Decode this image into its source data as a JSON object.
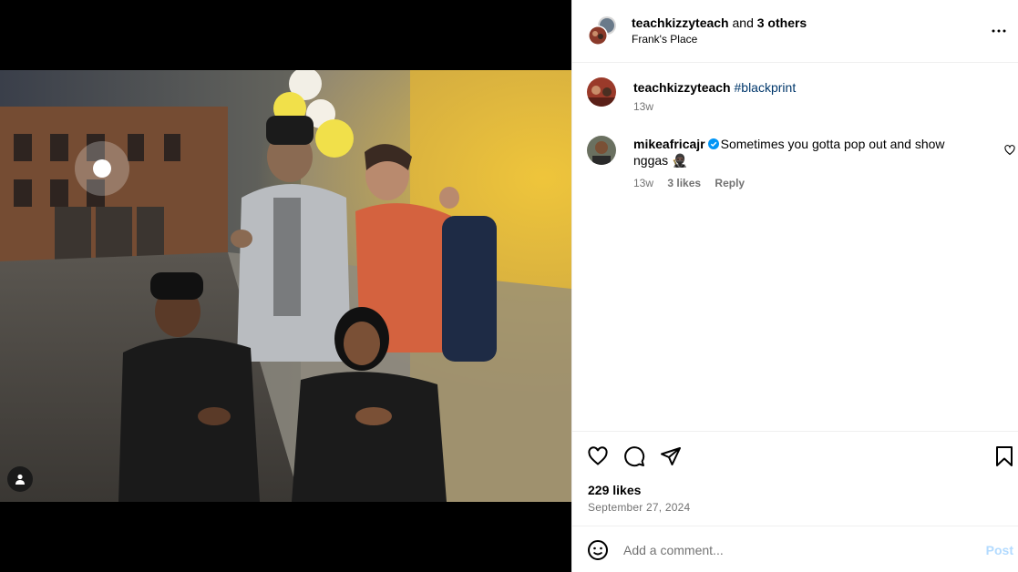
{
  "post": {
    "header": {
      "username": "teachkizzyteach",
      "and_text": "and",
      "others": "3 others",
      "location": "Frank's Place"
    },
    "caption": {
      "username": "teachkizzyteach",
      "hashtag": "#blackprint",
      "time": "13w"
    },
    "comments": [
      {
        "username": "mikeafricajr",
        "verified": true,
        "text": "Sometimes you gotta pop out and show nggas 🥷🏿",
        "time": "13w",
        "likes": "3 likes",
        "reply": "Reply"
      }
    ],
    "likes": "229 likes",
    "date": "September 27, 2024",
    "add_comment": {
      "placeholder": "Add a comment...",
      "post_label": "Post"
    }
  },
  "colors": {
    "link": "#00376b",
    "muted": "#737373",
    "verified": "#0095f6",
    "post_disabled": "#b3dbff"
  }
}
